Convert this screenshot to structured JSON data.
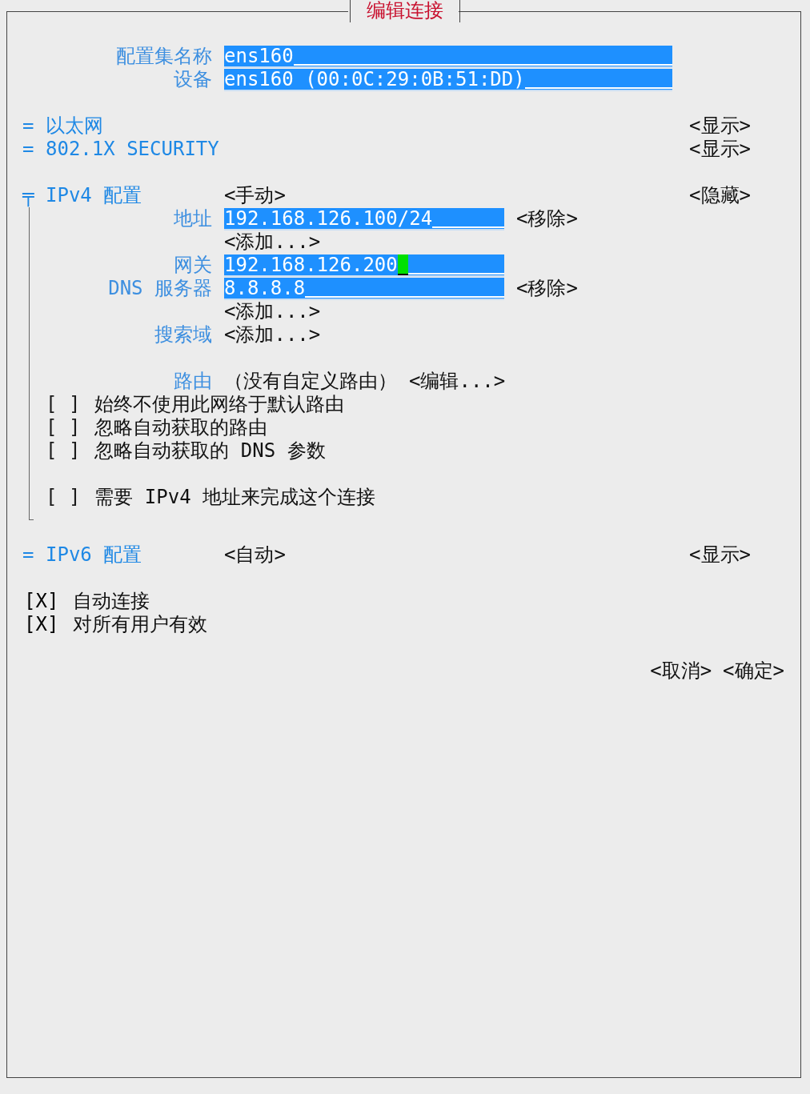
{
  "dialog": {
    "title": "编辑连接"
  },
  "profile": [
    {
      "label": "配置集名称",
      "value": "ens160"
    },
    {
      "label": "设备",
      "value": "ens160 (00:0C:29:0B:51:DD)"
    }
  ],
  "sections": [
    {
      "marker": "=",
      "title": "以太网",
      "toggle": "<显示>"
    },
    {
      "marker": "=",
      "title": "802.1X SECURITY",
      "toggle": "<显示>"
    },
    {
      "marker": "╤",
      "title": "IPv4 配置",
      "mode": "<手动>",
      "toggle": "<隐藏>",
      "body": {
        "rows": [
          {
            "kind": "field",
            "label": "地址",
            "value": "192.168.126.100/24",
            "focused": false,
            "action": "<移除>"
          },
          {
            "kind": "add",
            "button": "<添加...>"
          },
          {
            "kind": "field",
            "label": "网关",
            "value": "192.168.126.200",
            "focused": true
          },
          {
            "kind": "field",
            "label": "DNS 服务器",
            "value": "8.8.8.8",
            "focused": false,
            "action": "<移除>"
          },
          {
            "kind": "add",
            "button": "<添加...>"
          },
          {
            "kind": "add",
            "label": "搜索域",
            "button": "<添加...>"
          }
        ],
        "routing": {
          "label": "路由",
          "value": "（没有自定义路由）",
          "button": "<编辑...>"
        },
        "options": [
          {
            "box": "[ ]",
            "label": "始终不使用此网络于默认路由",
            "checked": false
          },
          {
            "box": "[ ]",
            "label": "忽略自动获取的路由",
            "checked": false
          },
          {
            "box": "[ ]",
            "label": "忽略自动获取的 DNS 参数",
            "checked": false
          }
        ],
        "requirement": {
          "box": "[ ]",
          "label": "需要 IPv4 地址来完成这个连接",
          "checked": false
        }
      }
    },
    {
      "marker": "=",
      "title": "IPv6 配置",
      "mode": "<自动>",
      "toggle": "<显示>"
    }
  ],
  "options": [
    {
      "box": "[X]",
      "label": "自动连接",
      "checked": true
    },
    {
      "box": "[X]",
      "label": "对所有用户有效",
      "checked": true
    }
  ],
  "buttons": [
    "<取消>",
    "<确定>"
  ]
}
